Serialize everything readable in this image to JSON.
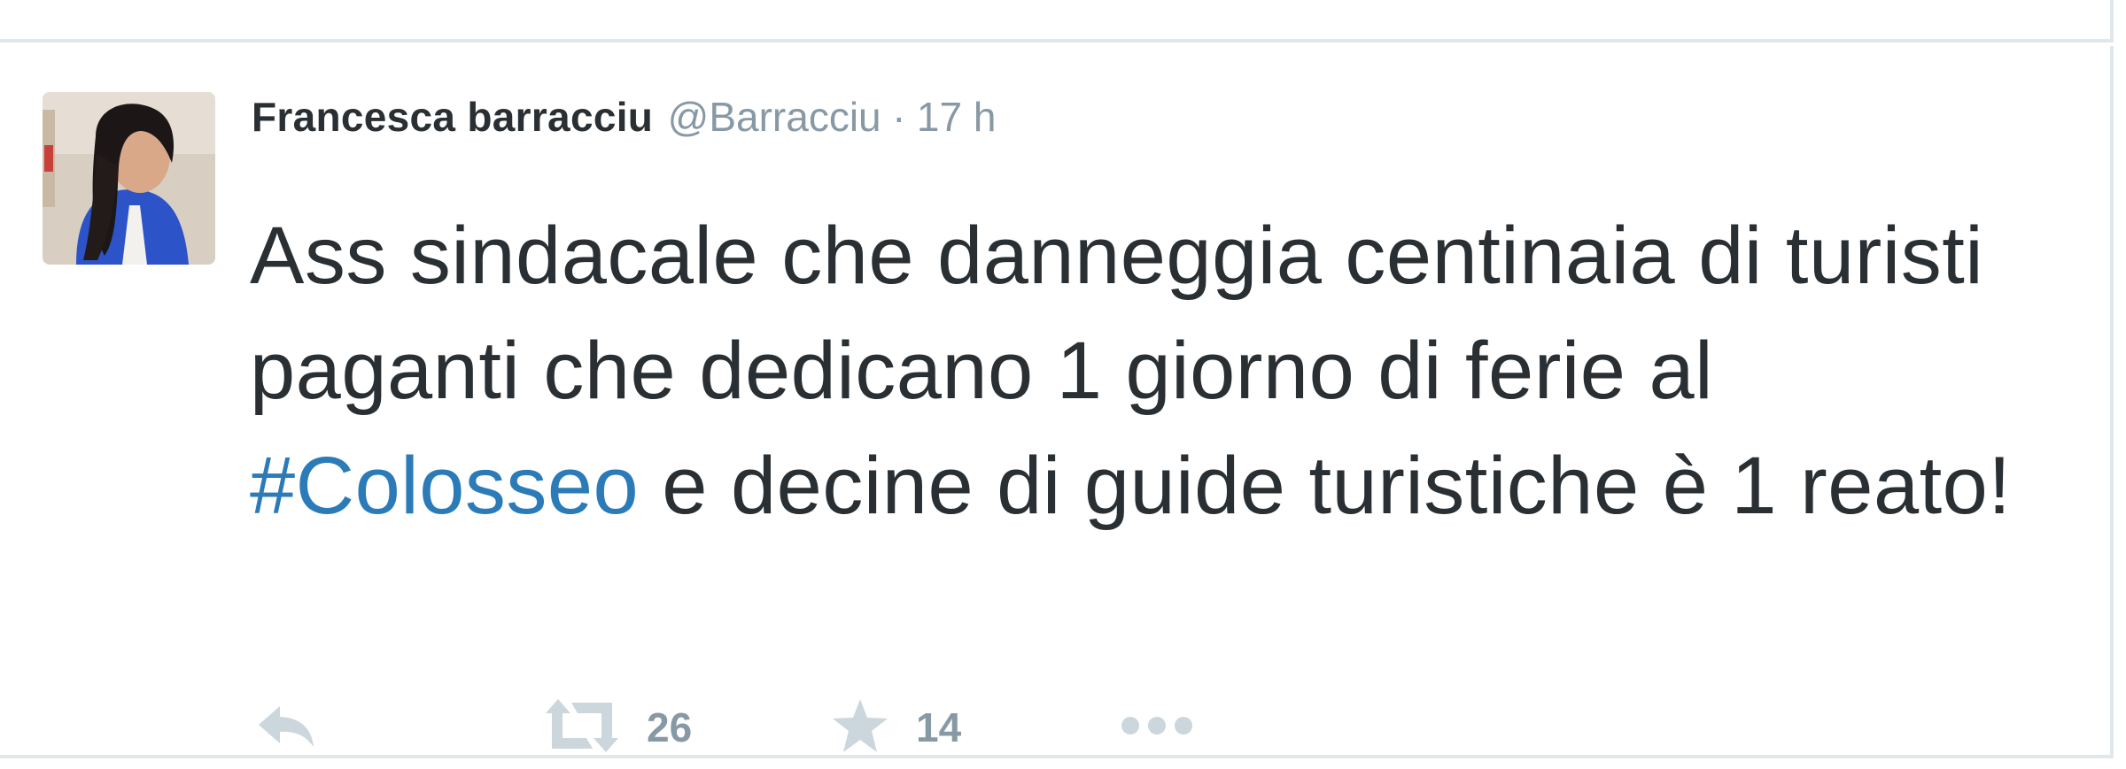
{
  "tweet": {
    "fullname": "Francesca barracciu",
    "username": "@Barracciu",
    "separator": "·",
    "time": "17 h",
    "text_part1": "Ass sindacale che danneggia centinaia di turisti paganti che dedicano 1 giorno di ferie al ",
    "hashtag": "#Colosseo",
    "text_part2": " e decine di guide turistiche è 1 reato!",
    "retweet_count": "26",
    "favorite_count": "14"
  },
  "icons": {
    "reply": "reply-icon",
    "retweet": "retweet-icon",
    "favorite": "star-icon",
    "more": "more-dots-icon"
  },
  "colors": {
    "text": "#292f33",
    "muted": "#8899a6",
    "icon": "#ccd6dd",
    "hashtag": "#2b7bb9",
    "border": "#e1e8ed"
  }
}
